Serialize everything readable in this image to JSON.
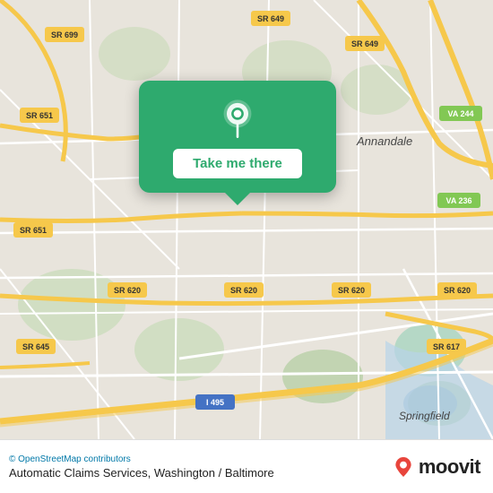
{
  "map": {
    "background_color": "#e8e0d8",
    "road_color": "#ffffff",
    "highway_color": "#f6c84b",
    "green_area_color": "#c8dbb8",
    "water_color": "#b8d4e8"
  },
  "popup": {
    "background_color": "#2eaa6e",
    "button_label": "Take me there",
    "pin_icon": "location-pin"
  },
  "bottom_bar": {
    "osm_credit": "© OpenStreetMap contributors",
    "location_title": "Automatic Claims Services, Washington / Baltimore",
    "moovit_text": "moovit",
    "moovit_pin_color": "#e8453c"
  }
}
